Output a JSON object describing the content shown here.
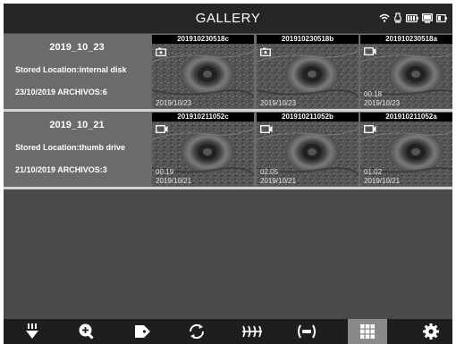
{
  "header": {
    "title": "GALLERY"
  },
  "status_icons": [
    "wifi-icon",
    "lamp-icon",
    "battery-icon",
    "monitor-icon",
    "battery-small-icon"
  ],
  "groups": [
    {
      "date": "2019_10_23",
      "location": "Stored Location:internal disk",
      "files": "23/10/2019 ARCHIVOS:6",
      "thumbs": [
        {
          "name": "201910230518c",
          "type": "photo",
          "duration": "",
          "date": "2019/10/23"
        },
        {
          "name": "201910230518b",
          "type": "photo",
          "duration": "",
          "date": "2019/10/23"
        },
        {
          "name": "201910230518a",
          "type": "video",
          "duration": "00:18",
          "date": "2019/10/23"
        }
      ]
    },
    {
      "date": "2019_10_21",
      "location": "Stored Location:thumb drive",
      "files": "21/10/2019 ARCHIVOS:3",
      "thumbs": [
        {
          "name": "201910211052c",
          "type": "video",
          "duration": "00:19",
          "date": "2019/10/21"
        },
        {
          "name": "201910211052b",
          "type": "video",
          "duration": "02:05",
          "date": "2019/10/21"
        },
        {
          "name": "201910211052a",
          "type": "video",
          "duration": "01:02",
          "date": "2019/10/21"
        }
      ]
    }
  ],
  "toolbar": {
    "items": [
      "light-icon",
      "zoom-in-icon",
      "tag-icon",
      "rotate-icon",
      "filter-icon",
      "record-icon",
      "gallery-grid-icon",
      "settings-icon"
    ],
    "active": "gallery-grid-icon"
  },
  "colors": {
    "accent_active": "#8a8a8a",
    "header_bg": "#262626",
    "row_bg": "#6b6b6b",
    "toolbar_bg": "#1e1e1e"
  }
}
